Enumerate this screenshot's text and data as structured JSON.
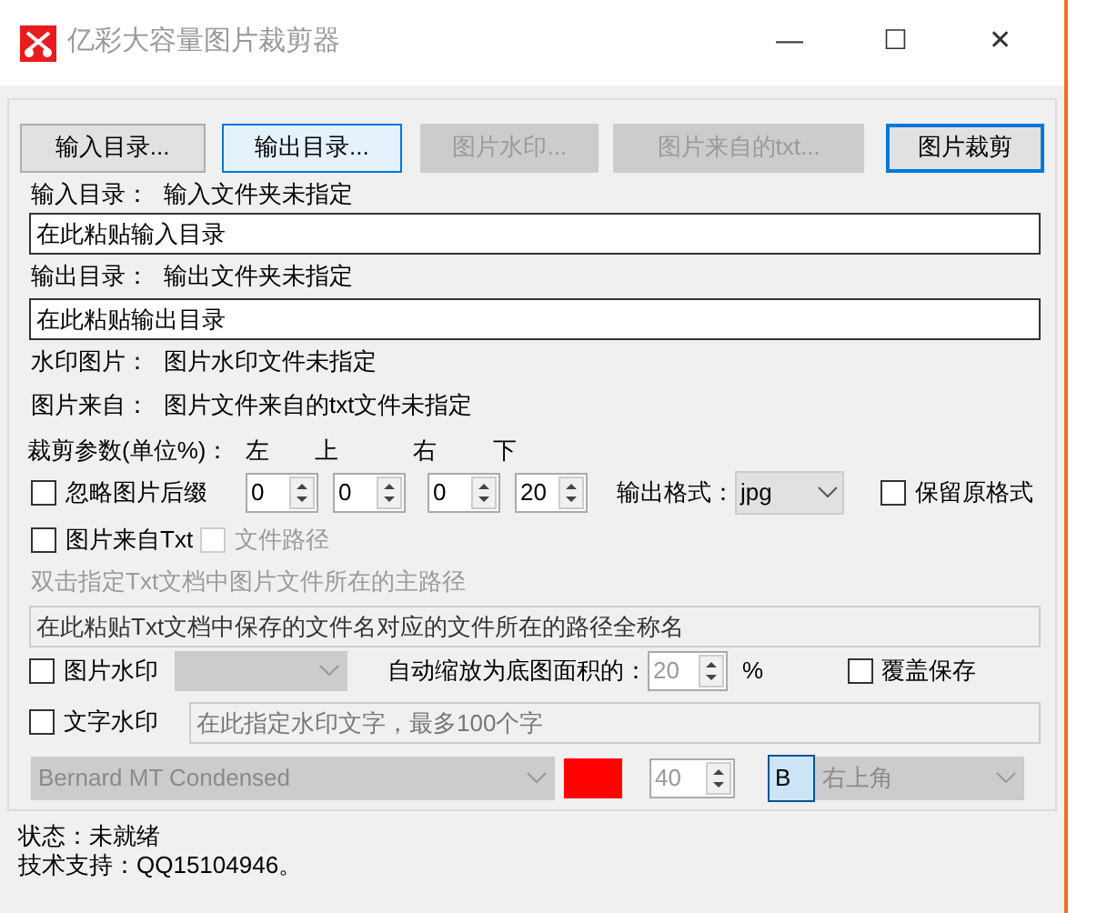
{
  "window": {
    "title": "亿彩大容量图片裁剪器",
    "controls": [
      "—",
      "☐",
      "✕"
    ]
  },
  "buttons": [
    {
      "label": "输入目录...",
      "disabled": false,
      "focused": false,
      "default": false
    },
    {
      "label": "输出目录...",
      "disabled": false,
      "focused": true,
      "default": false
    },
    {
      "label": "图片水印...",
      "disabled": true,
      "focused": false,
      "default": false
    },
    {
      "label": "图片来自的txt...",
      "disabled": true,
      "focused": false,
      "default": false
    },
    {
      "label": "图片裁剪",
      "disabled": false,
      "focused": false,
      "default": true
    }
  ],
  "input_dir": {
    "label": "输入目录：",
    "status": "输入文件夹未指定",
    "placeholder": "在此粘贴输入目录"
  },
  "output_dir": {
    "label": "输出目录：",
    "status": "输出文件夹未指定",
    "placeholder": "在此粘贴输出目录"
  },
  "watermark_image": {
    "label": "水印图片：",
    "status": "图片水印文件未指定"
  },
  "image_source": {
    "label": "图片来自：",
    "status": "图片文件来自的txt文件未指定"
  },
  "crop": {
    "label": "裁剪参数(单位%)：",
    "headers": [
      "左",
      "上",
      "右",
      "下"
    ],
    "values": [
      "0",
      "0",
      "0",
      "20"
    ]
  },
  "ignore_suffix": {
    "label": "忽略图片后缀",
    "checked": false
  },
  "output_format": {
    "label": "输出格式：",
    "value": "jpg"
  },
  "keep_format": {
    "label": "保留原格式",
    "checked": false
  },
  "from_txt": {
    "label": "图片来自Txt",
    "checked": false
  },
  "file_path": {
    "label": "文件路径",
    "checked": false,
    "disabled": true
  },
  "main_path_hint": "双击指定Txt文档中图片文件所在的主路径",
  "full_path": {
    "placeholder": "在此粘贴Txt文档中保存的文件名对应的文件所在的路径全称名"
  },
  "image_watermark": {
    "label": "图片水印",
    "checked": false
  },
  "auto_scale": {
    "label": "自动缩放为底图面积的：",
    "value": "20",
    "unit": "%"
  },
  "overwrite": {
    "label": "覆盖保存",
    "checked": false
  },
  "text_watermark": {
    "label": "文字水印",
    "checked": false,
    "placeholder": "在此指定水印文字，最多100个字"
  },
  "font": {
    "value": "Bernard MT Condensed",
    "color": "#ff0000",
    "size": "40",
    "bold": "B",
    "bold_on": true,
    "position": "右上角"
  },
  "status": "状态：未就绪",
  "support": "技术支持：QQ15104946。"
}
